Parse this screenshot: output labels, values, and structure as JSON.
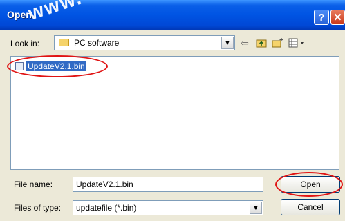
{
  "window": {
    "title": "Open",
    "watermark": "www."
  },
  "titlebar": {
    "help_glyph": "?",
    "close_glyph": "✕"
  },
  "lookin": {
    "label": "Look in:",
    "value": "PC software"
  },
  "toolbar": {
    "icons": [
      "back-arrow-icon",
      "up-folder-icon",
      "new-folder-icon",
      "view-menu-icon"
    ]
  },
  "files": [
    {
      "name": "UpdateV2.1.bin",
      "selected": true
    }
  ],
  "filename": {
    "label": "File name:",
    "value": "UpdateV2.1.bin"
  },
  "filetype": {
    "label": "Files of type:",
    "value": "updatefile (*.bin)"
  },
  "buttons": {
    "open": "Open",
    "cancel": "Cancel"
  },
  "colors": {
    "titlebar": "#0054e3",
    "selection": "#316ac5",
    "annotation": "#e01313",
    "dialog": "#ece9d8"
  }
}
